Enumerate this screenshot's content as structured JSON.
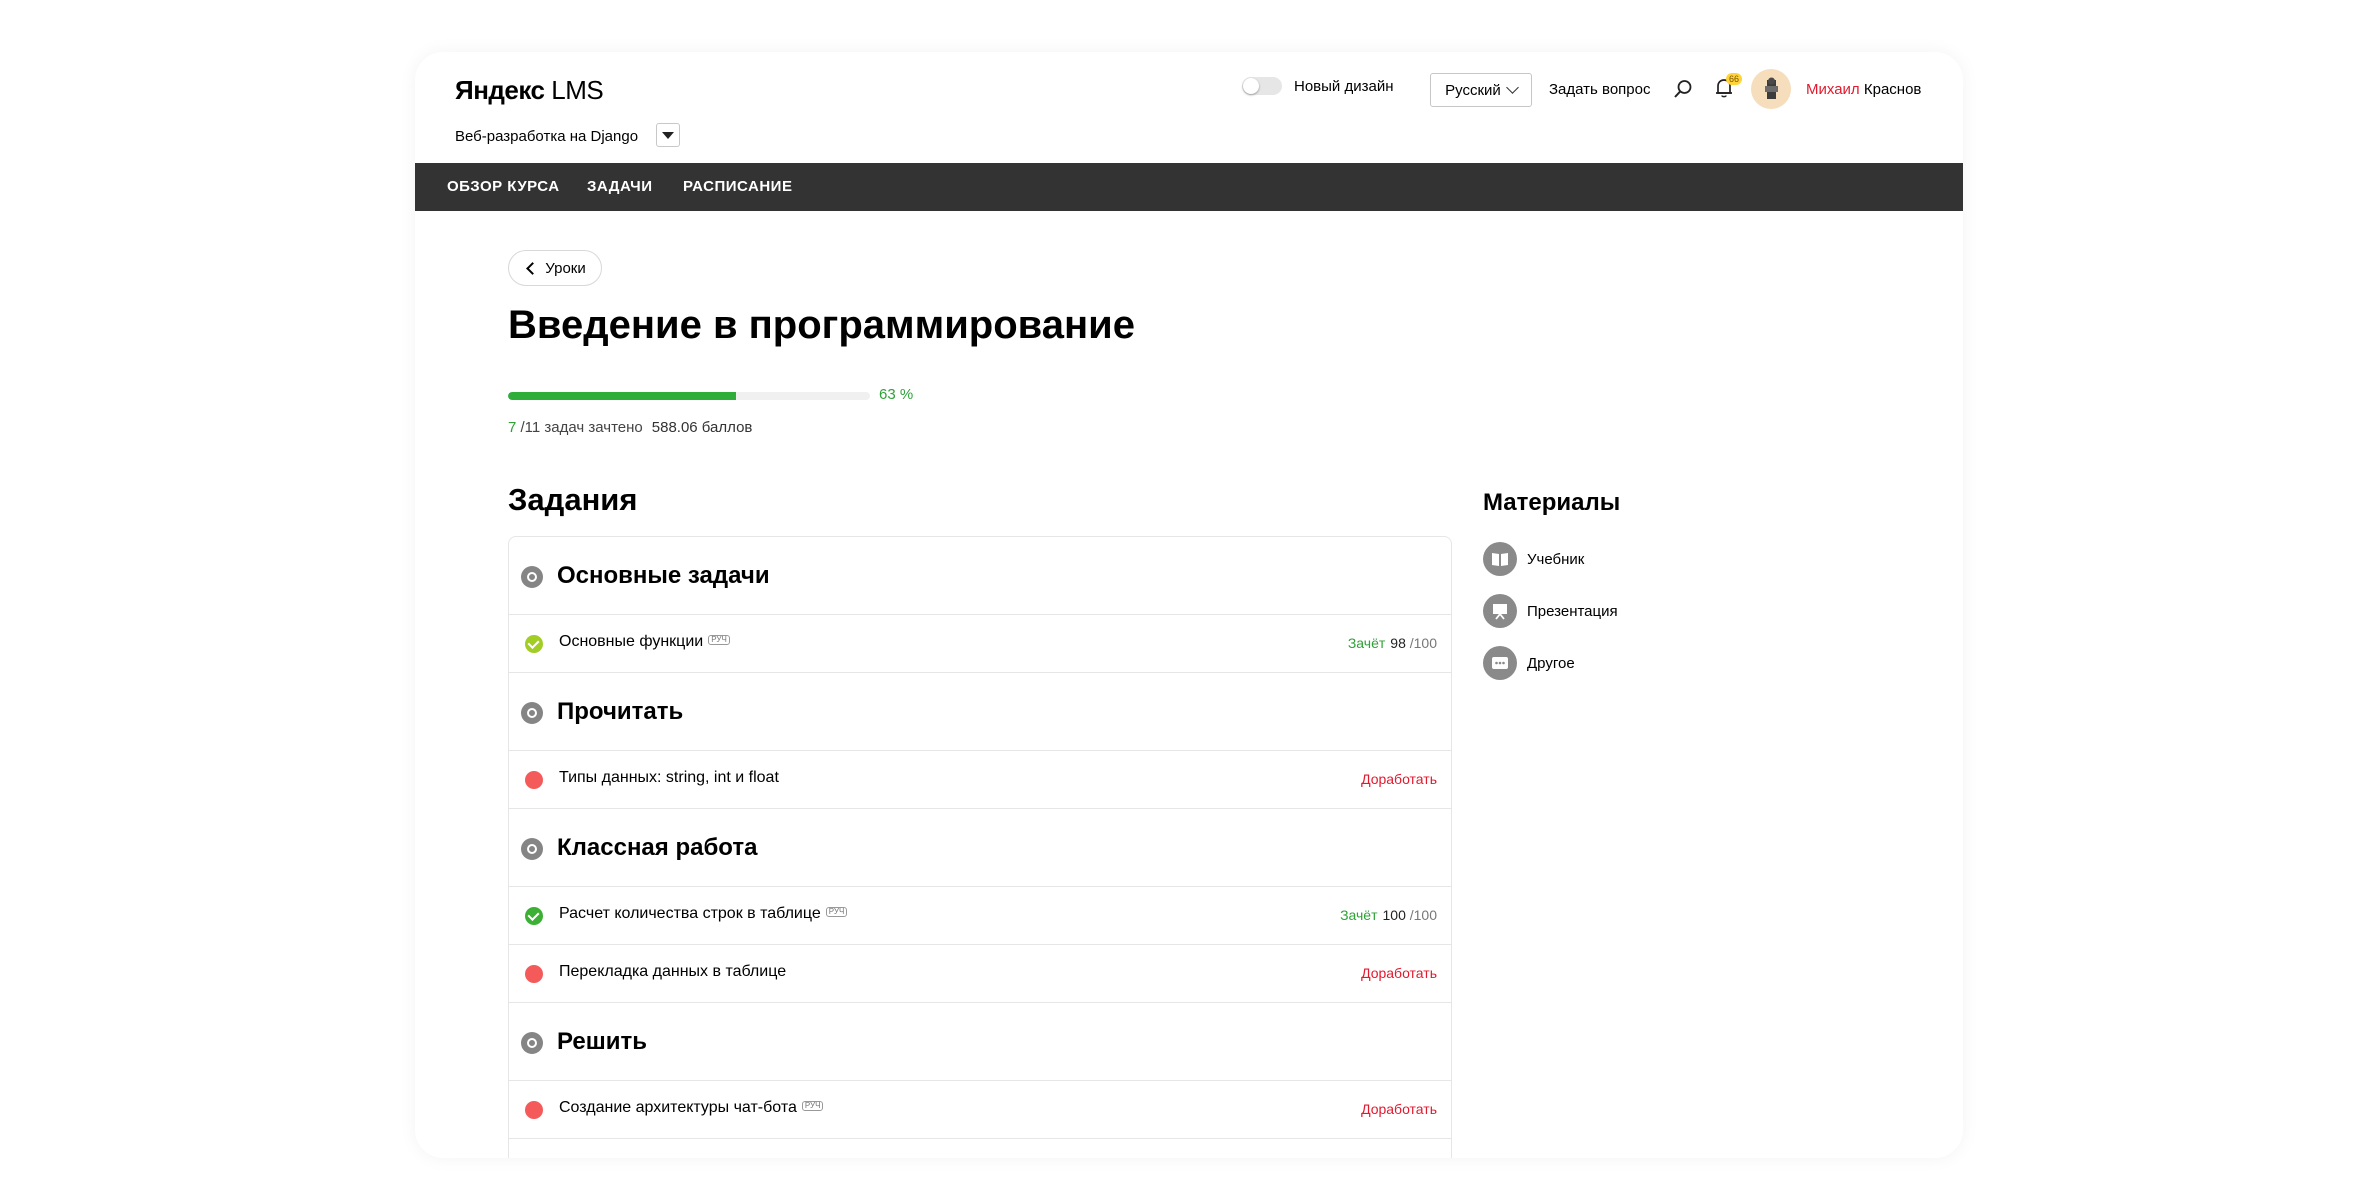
{
  "app": {
    "brand_bold": "Яндекс",
    "brand_light": "LMS",
    "course_name": "Веб-разработка на Django"
  },
  "header": {
    "new_design_label": "Новый дизайн",
    "new_design_enabled": false,
    "language": "Русский",
    "ask_question": "Задать вопрос",
    "notifications_count": "66",
    "user_first": "Михаил",
    "user_last": "Краснов"
  },
  "nav": {
    "items": [
      "ОБЗОР КУРСА",
      "ЗАДАЧИ",
      "РАСПИСАНИЕ"
    ]
  },
  "lesson": {
    "back_label": "Уроки",
    "title": "Введение в программирование",
    "progress_percent": 63,
    "progress_label": "63 %",
    "solved": "7",
    "total": "/11 задач зачтено",
    "points": "588.06 баллов"
  },
  "tasks": {
    "heading": "Задания",
    "groups": [
      {
        "title": "Основные задачи",
        "items": [
          {
            "name": "Основные функции",
            "tag": "РУЧ",
            "status": "Зачёт",
            "score": "98",
            "max": "/100",
            "state": "ok"
          }
        ]
      },
      {
        "title": "Прочитать",
        "items": [
          {
            "name": "Типы данных: string, int и float",
            "tag": "",
            "status": "Доработать",
            "score": "",
            "max": "",
            "state": "bad"
          }
        ]
      },
      {
        "title": "Классная работа",
        "items": [
          {
            "name": "Расчет количества строк в таблице",
            "tag": "РУЧ",
            "status": "Зачёт",
            "score": "100",
            "max": "/100",
            "state": "ok"
          },
          {
            "name": "Перекладка данных в таблице",
            "tag": "",
            "status": "Доработать",
            "score": "",
            "max": "",
            "state": "bad"
          }
        ]
      },
      {
        "title": "Решить",
        "items": [
          {
            "name": "Создание архитектуры чат-бота",
            "tag": "РУЧ",
            "status": "Доработать",
            "score": "",
            "max": "",
            "state": "bad"
          }
        ]
      }
    ]
  },
  "materials": {
    "heading": "Материалы",
    "items": [
      {
        "label": "Учебник",
        "icon": "book-icon"
      },
      {
        "label": "Презентация",
        "icon": "presentation-icon"
      },
      {
        "label": "Другое",
        "icon": "more-icon"
      }
    ]
  },
  "colors": {
    "accent_green": "#2fa237",
    "error_red": "#e3192d",
    "nav_bg": "#333333"
  }
}
